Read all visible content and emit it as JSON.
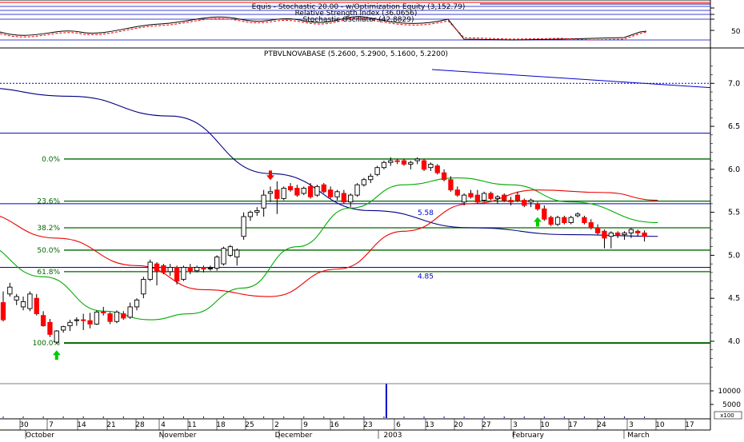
{
  "chart_data": {
    "type": "candlestick",
    "instrument": "PTBVLNOVABASE",
    "ohlc_label": "PTBVLNOVABASE (5.2600, 5.2900, 5.1600, 5.2200)",
    "top_panel": {
      "titles": [
        "Equis - Stochastic 20.00 - w/Optimization Equity (3,152.79)",
        "Relative Strength Index (36.0656)",
        "Stochastic Oscillator (42.8829)"
      ],
      "y_tick": "50"
    },
    "price_axis": {
      "ticks": [
        "7.0",
        "6.5",
        "6.0",
        "5.5",
        "5.0",
        "4.5",
        "4.0"
      ],
      "ylim": [
        3.6,
        7.3
      ]
    },
    "volume_axis": {
      "ticks": [
        "10000",
        "5000"
      ],
      "multiplier_label": "x100"
    },
    "fibonacci_levels": [
      {
        "label": "0.0%",
        "price": 6.12
      },
      {
        "label": "23.6%",
        "price": 5.63
      },
      {
        "label": "38.2%",
        "price": 5.32
      },
      {
        "label": "50.0%",
        "price": 5.06
      },
      {
        "label": "61.8%",
        "price": 4.81
      },
      {
        "label": "100.0%",
        "price": 3.98
      }
    ],
    "horizontal_lines": [
      {
        "label": "5.58",
        "price": 5.6
      },
      {
        "label": "4.85",
        "price": 4.86
      }
    ],
    "x_ticks": [
      "30",
      "7",
      "14",
      "21",
      "28",
      "4",
      "11",
      "18",
      "25",
      "2",
      "9",
      "16",
      "23",
      "6",
      "13",
      "20",
      "27",
      "3",
      "10",
      "17",
      "24",
      "3",
      "10",
      "17"
    ],
    "month_labels": [
      "October",
      "November",
      "December",
      "2003",
      "February",
      "March"
    ],
    "candles": [
      {
        "o": 4.45,
        "h": 4.58,
        "l": 4.23,
        "c": 4.25
      },
      {
        "o": 4.55,
        "h": 4.68,
        "l": 4.52,
        "c": 4.63
      },
      {
        "o": 4.48,
        "h": 4.55,
        "l": 4.42,
        "c": 4.52
      },
      {
        "o": 4.4,
        "h": 4.52,
        "l": 4.36,
        "c": 4.46
      },
      {
        "o": 4.38,
        "h": 4.58,
        "l": 4.35,
        "c": 4.55
      },
      {
        "o": 4.5,
        "h": 4.55,
        "l": 4.3,
        "c": 4.32
      },
      {
        "o": 4.3,
        "h": 4.35,
        "l": 4.17,
        "c": 4.18
      },
      {
        "o": 4.22,
        "h": 4.26,
        "l": 4.05,
        "c": 4.08
      },
      {
        "o": 3.99,
        "h": 4.13,
        "l": 3.97,
        "c": 4.12
      },
      {
        "o": 4.13,
        "h": 4.18,
        "l": 4.1,
        "c": 4.17
      },
      {
        "o": 4.18,
        "h": 4.25,
        "l": 4.12,
        "c": 4.22
      },
      {
        "o": 4.24,
        "h": 4.28,
        "l": 4.18,
        "c": 4.25
      },
      {
        "o": 4.25,
        "h": 4.32,
        "l": 4.13,
        "c": 4.24
      },
      {
        "o": 4.24,
        "h": 4.33,
        "l": 4.15,
        "c": 4.2
      },
      {
        "o": 4.2,
        "h": 4.36,
        "l": 4.19,
        "c": 4.34
      },
      {
        "o": 4.34,
        "h": 4.4,
        "l": 4.3,
        "c": 4.33
      },
      {
        "o": 4.32,
        "h": 4.34,
        "l": 4.2,
        "c": 4.23
      },
      {
        "o": 4.23,
        "h": 4.36,
        "l": 4.21,
        "c": 4.34
      },
      {
        "o": 4.32,
        "h": 4.35,
        "l": 4.25,
        "c": 4.27
      },
      {
        "o": 4.28,
        "h": 4.45,
        "l": 4.26,
        "c": 4.4
      },
      {
        "o": 4.4,
        "h": 4.5,
        "l": 4.36,
        "c": 4.48
      },
      {
        "o": 4.55,
        "h": 4.75,
        "l": 4.5,
        "c": 4.72
      },
      {
        "o": 4.72,
        "h": 4.95,
        "l": 4.7,
        "c": 4.92
      },
      {
        "o": 4.9,
        "h": 4.92,
        "l": 4.65,
        "c": 4.82
      },
      {
        "o": 4.88,
        "h": 4.9,
        "l": 4.78,
        "c": 4.8
      },
      {
        "o": 4.81,
        "h": 4.9,
        "l": 4.76,
        "c": 4.86
      },
      {
        "o": 4.86,
        "h": 4.88,
        "l": 4.66,
        "c": 4.7
      },
      {
        "o": 4.72,
        "h": 4.88,
        "l": 4.7,
        "c": 4.86
      },
      {
        "o": 4.86,
        "h": 4.9,
        "l": 4.78,
        "c": 4.82
      },
      {
        "o": 4.82,
        "h": 4.88,
        "l": 4.8,
        "c": 4.86
      },
      {
        "o": 4.86,
        "h": 4.88,
        "l": 4.8,
        "c": 4.84
      },
      {
        "o": 4.85,
        "h": 4.88,
        "l": 4.82,
        "c": 4.85
      },
      {
        "o": 4.85,
        "h": 5.0,
        "l": 4.82,
        "c": 4.98
      },
      {
        "o": 4.9,
        "h": 5.1,
        "l": 4.88,
        "c": 5.08
      },
      {
        "o": 5.0,
        "h": 5.12,
        "l": 4.98,
        "c": 5.1
      },
      {
        "o": 4.98,
        "h": 5.08,
        "l": 4.88,
        "c": 5.06
      },
      {
        "o": 5.22,
        "h": 5.5,
        "l": 5.18,
        "c": 5.45
      },
      {
        "o": 5.45,
        "h": 5.52,
        "l": 5.4,
        "c": 5.5
      },
      {
        "o": 5.5,
        "h": 5.56,
        "l": 5.46,
        "c": 5.52
      },
      {
        "o": 5.55,
        "h": 5.76,
        "l": 5.45,
        "c": 5.7
      },
      {
        "o": 5.72,
        "h": 5.8,
        "l": 5.62,
        "c": 5.74
      },
      {
        "o": 5.76,
        "h": 5.86,
        "l": 5.48,
        "c": 5.66
      },
      {
        "o": 5.66,
        "h": 5.8,
        "l": 5.64,
        "c": 5.78
      },
      {
        "o": 5.8,
        "h": 5.84,
        "l": 5.74,
        "c": 5.76
      },
      {
        "o": 5.78,
        "h": 5.82,
        "l": 5.68,
        "c": 5.7
      },
      {
        "o": 5.72,
        "h": 5.8,
        "l": 5.7,
        "c": 5.78
      },
      {
        "o": 5.8,
        "h": 5.84,
        "l": 5.66,
        "c": 5.68
      },
      {
        "o": 5.7,
        "h": 5.82,
        "l": 5.68,
        "c": 5.8
      },
      {
        "o": 5.82,
        "h": 5.84,
        "l": 5.72,
        "c": 5.74
      },
      {
        "o": 5.76,
        "h": 5.8,
        "l": 5.66,
        "c": 5.68
      },
      {
        "o": 5.68,
        "h": 5.76,
        "l": 5.64,
        "c": 5.74
      },
      {
        "o": 5.72,
        "h": 5.76,
        "l": 5.6,
        "c": 5.62
      },
      {
        "o": 5.62,
        "h": 5.72,
        "l": 5.56,
        "c": 5.7
      },
      {
        "o": 5.7,
        "h": 5.84,
        "l": 5.68,
        "c": 5.82
      },
      {
        "o": 5.82,
        "h": 5.9,
        "l": 5.8,
        "c": 5.88
      },
      {
        "o": 5.88,
        "h": 5.95,
        "l": 5.84,
        "c": 5.92
      },
      {
        "o": 5.94,
        "h": 6.04,
        "l": 5.92,
        "c": 6.02
      },
      {
        "o": 6.02,
        "h": 6.1,
        "l": 6.0,
        "c": 6.08
      },
      {
        "o": 6.08,
        "h": 6.14,
        "l": 6.04,
        "c": 6.1
      },
      {
        "o": 6.1,
        "h": 6.12,
        "l": 6.06,
        "c": 6.09
      },
      {
        "o": 6.1,
        "h": 6.12,
        "l": 6.04,
        "c": 6.06
      },
      {
        "o": 6.06,
        "h": 6.1,
        "l": 6.0,
        "c": 6.08
      },
      {
        "o": 6.1,
        "h": 6.14,
        "l": 6.06,
        "c": 6.12
      },
      {
        "o": 6.1,
        "h": 6.12,
        "l": 5.98,
        "c": 6.0
      },
      {
        "o": 6.02,
        "h": 6.08,
        "l": 5.98,
        "c": 6.06
      },
      {
        "o": 6.04,
        "h": 6.06,
        "l": 5.94,
        "c": 5.96
      },
      {
        "o": 5.96,
        "h": 6.0,
        "l": 5.86,
        "c": 5.88
      },
      {
        "o": 5.88,
        "h": 5.92,
        "l": 5.74,
        "c": 5.76
      },
      {
        "o": 5.76,
        "h": 5.8,
        "l": 5.68,
        "c": 5.7
      },
      {
        "o": 5.62,
        "h": 5.72,
        "l": 5.58,
        "c": 5.7
      },
      {
        "o": 5.72,
        "h": 5.76,
        "l": 5.66,
        "c": 5.68
      },
      {
        "o": 5.7,
        "h": 5.76,
        "l": 5.6,
        "c": 5.62
      },
      {
        "o": 5.64,
        "h": 5.74,
        "l": 5.62,
        "c": 5.72
      },
      {
        "o": 5.72,
        "h": 5.74,
        "l": 5.64,
        "c": 5.66
      },
      {
        "o": 5.66,
        "h": 5.7,
        "l": 5.6,
        "c": 5.68
      },
      {
        "o": 5.7,
        "h": 5.72,
        "l": 5.62,
        "c": 5.64
      },
      {
        "o": 5.64,
        "h": 5.68,
        "l": 5.58,
        "c": 5.62
      },
      {
        "o": 5.7,
        "h": 5.74,
        "l": 5.62,
        "c": 5.64
      },
      {
        "o": 5.64,
        "h": 5.66,
        "l": 5.56,
        "c": 5.58
      },
      {
        "o": 5.62,
        "h": 5.66,
        "l": 5.56,
        "c": 5.64
      },
      {
        "o": 5.6,
        "h": 5.62,
        "l": 5.52,
        "c": 5.54
      },
      {
        "o": 5.54,
        "h": 5.58,
        "l": 5.4,
        "c": 5.42
      },
      {
        "o": 5.44,
        "h": 5.46,
        "l": 5.34,
        "c": 5.36
      },
      {
        "o": 5.36,
        "h": 5.46,
        "l": 5.34,
        "c": 5.44
      },
      {
        "o": 5.44,
        "h": 5.46,
        "l": 5.36,
        "c": 5.38
      },
      {
        "o": 5.38,
        "h": 5.46,
        "l": 5.36,
        "c": 5.44
      },
      {
        "o": 5.46,
        "h": 5.5,
        "l": 5.44,
        "c": 5.48
      },
      {
        "o": 5.44,
        "h": 5.46,
        "l": 5.36,
        "c": 5.38
      },
      {
        "o": 5.38,
        "h": 5.42,
        "l": 5.3,
        "c": 5.32
      },
      {
        "o": 5.32,
        "h": 5.36,
        "l": 5.24,
        "c": 5.26
      },
      {
        "o": 5.28,
        "h": 5.3,
        "l": 5.08,
        "c": 5.2
      },
      {
        "o": 5.22,
        "h": 5.28,
        "l": 5.08,
        "c": 5.26
      },
      {
        "o": 5.26,
        "h": 5.28,
        "l": 5.2,
        "c": 5.24
      },
      {
        "o": 5.24,
        "h": 5.28,
        "l": 5.18,
        "c": 5.26
      },
      {
        "o": 5.26,
        "h": 5.32,
        "l": 5.2,
        "c": 5.3
      },
      {
        "o": 5.28,
        "h": 5.3,
        "l": 5.22,
        "c": 5.26
      },
      {
        "o": 5.26,
        "h": 5.29,
        "l": 5.16,
        "c": 5.22
      }
    ],
    "arrows": [
      {
        "type": "up",
        "color": "#00cc00",
        "bar": 8
      },
      {
        "type": "down",
        "color": "#ff0000",
        "bar": 40
      },
      {
        "type": "up",
        "color": "#00cc00",
        "bar": 80
      }
    ],
    "moving_averages": [
      {
        "color": "#000080",
        "points": [
          [
            -4,
            6.95
          ],
          [
            10,
            6.85
          ],
          [
            25,
            6.62
          ],
          [
            40,
            5.95
          ],
          [
            55,
            5.52
          ],
          [
            70,
            5.32
          ],
          [
            85,
            5.24
          ],
          [
            98,
            5.22
          ]
        ]
      },
      {
        "color": "#00aa00",
        "points": [
          [
            -4,
            5.15
          ],
          [
            6,
            4.75
          ],
          [
            15,
            4.35
          ],
          [
            22,
            4.25
          ],
          [
            28,
            4.32
          ],
          [
            36,
            4.62
          ],
          [
            44,
            5.1
          ],
          [
            52,
            5.55
          ],
          [
            60,
            5.82
          ],
          [
            68,
            5.9
          ],
          [
            76,
            5.82
          ],
          [
            85,
            5.62
          ],
          [
            98,
            5.38
          ]
        ]
      },
      {
        "color": "#ee0000",
        "points": [
          [
            -4,
            5.5
          ],
          [
            8,
            5.2
          ],
          [
            20,
            4.88
          ],
          [
            30,
            4.6
          ],
          [
            40,
            4.52
          ],
          [
            50,
            4.84
          ],
          [
            60,
            5.28
          ],
          [
            70,
            5.6
          ],
          [
            80,
            5.76
          ],
          [
            90,
            5.73
          ],
          [
            98,
            5.64
          ]
        ]
      }
    ],
    "volume": [
      {
        "bar": 57,
        "value": 12500,
        "color": "#0000cc"
      }
    ],
    "colors": {
      "up_candle": "#ffffff",
      "down_candle": "#ff0000",
      "fib_line": "#006600",
      "horizontal_line": "#0000cc",
      "frame": "#000000"
    }
  }
}
